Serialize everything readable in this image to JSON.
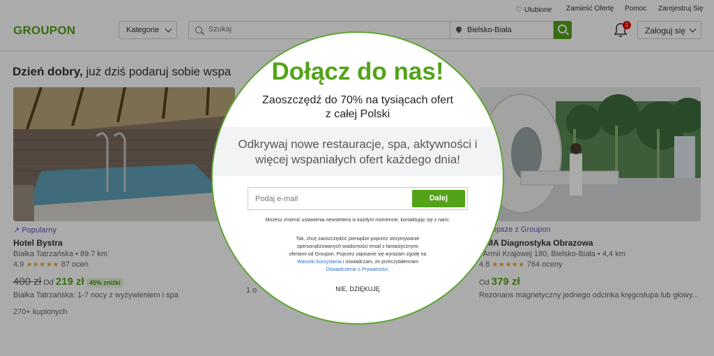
{
  "util": {
    "favorites": "Ulubione",
    "place_offer": "Zamieść Ofertę",
    "help": "Pomoc",
    "register": "Zarejestruj Się"
  },
  "header": {
    "logo": "GROUPON",
    "categories": "Kategorie",
    "search_placeholder": "Szukaj",
    "location": "Bielsko-Biała",
    "notification_count": "1",
    "login": "Zaloguj się"
  },
  "greeting": {
    "bold": "Dzień dobry,",
    "rest": " już dziś podaruj sobie wspa"
  },
  "cards": [
    {
      "tag": "Popularny",
      "title": "Hotel Bystra",
      "location": "Białka Tatrzańska • 89.7 km",
      "rating": "4.9",
      "stars": "★★★★★",
      "reviews": "87 ocen",
      "old_price": "400 zł",
      "from": "Od",
      "new_price": "219 zł",
      "discount": "45% zniżki",
      "desc": "Białka Tatrzańska: 1-7 nocy z wyżywieniem i spa",
      "sold": "270+ kupionych"
    },
    {
      "partial_text": "1 o"
    },
    {
      "tag": "Najlepsze z Groupon",
      "title": "MMA Diagnostyka Obrazowa",
      "location": ". Armii Krajowej 180, Bielsko-Biała • 4,4 km",
      "rating": "4.8",
      "stars": "★★★★★",
      "reviews": "764 oceny",
      "from": "Od",
      "new_price": "379 zł",
      "desc": "Rezonans magnetyczny jednego odcinka kręgosłupa lub głowy..."
    }
  ],
  "popup": {
    "title": "Dołącz do nas!",
    "subtitle_1": "Zaoszczędź do 70% na tysiącach ofert",
    "subtitle_2": "z całej Polski",
    "band_1": "Odkrywaj nowe restauracje, spa, aktywności i",
    "band_2": "więcej wspaniałych ofert każdego dnia!",
    "email_placeholder": "Podaj e-mail",
    "submit": "Dalej",
    "unsubscribe_note": "Możesz zmienić ustawienia newslettera w każdym momencie, kontaktując się z nami.",
    "consent_1": "Tak, chcę zaoszczędzić pieniądze poprzez otrzymywanie",
    "consent_2": "spersonalizowanych wiadomości email z fantastycznymi",
    "consent_3": "ofertami od Groupon. Poprzez zapisanie się wyrażam zgodę na",
    "terms_link": "Warunki Korzystania",
    "consent_4": " i oświadczam, że przeczytałem/am",
    "privacy_link": "Oświadczenie o Prywatności",
    "consent_end": ".",
    "decline": "NIE, DZIĘKUJĘ"
  },
  "colors": {
    "brand_green": "#53a318",
    "tag_purple": "#6b4fbb",
    "badge_red": "#e00000"
  }
}
